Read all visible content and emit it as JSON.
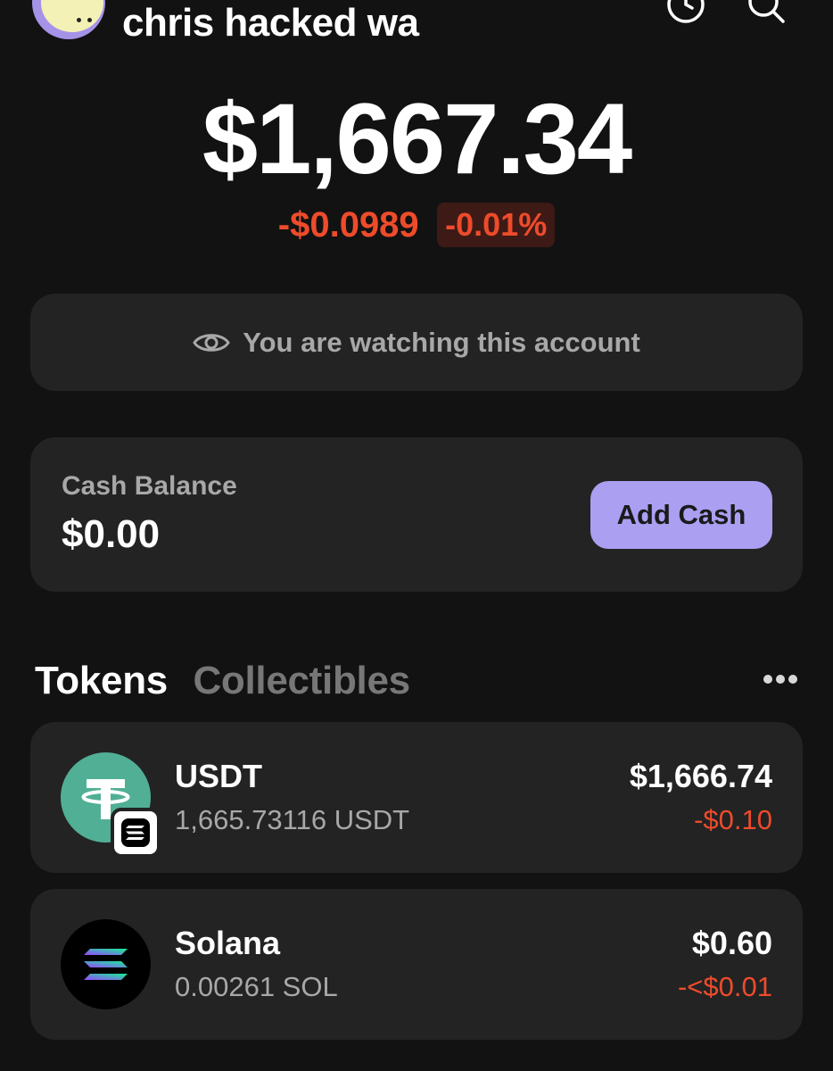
{
  "header": {
    "account_name": "chris hacked wa",
    "history_icon": "clock-icon",
    "search_icon": "search-icon"
  },
  "balance": {
    "total": "$1,667.34",
    "change_amount": "-$0.0989",
    "change_percent": "-0.01%"
  },
  "watch_banner": {
    "icon": "eye-icon",
    "text": "You are watching this account"
  },
  "cash": {
    "label": "Cash Balance",
    "value": "$0.00",
    "button_label": "Add Cash"
  },
  "tabs": [
    {
      "label": "Tokens",
      "active": true
    },
    {
      "label": "Collectibles",
      "active": false
    }
  ],
  "more_icon": "more-horizontal-icon",
  "tokens": [
    {
      "name": "USDT",
      "quantity": "1,665.73116 USDT",
      "value": "$1,666.74",
      "change": "-$0.10",
      "logo_icon": "tether-logo-icon",
      "chain_icon": "solana-chain-badge-icon"
    },
    {
      "name": "Solana",
      "quantity": "0.00261 SOL",
      "value": "$0.60",
      "change": "-<$0.01",
      "logo_icon": "solana-logo-icon"
    }
  ],
  "colors": {
    "background": "#121212",
    "card": "#232323",
    "accent": "#ab9ff2",
    "negative": "#ee4b2b",
    "usdt_green": "#50af95"
  }
}
